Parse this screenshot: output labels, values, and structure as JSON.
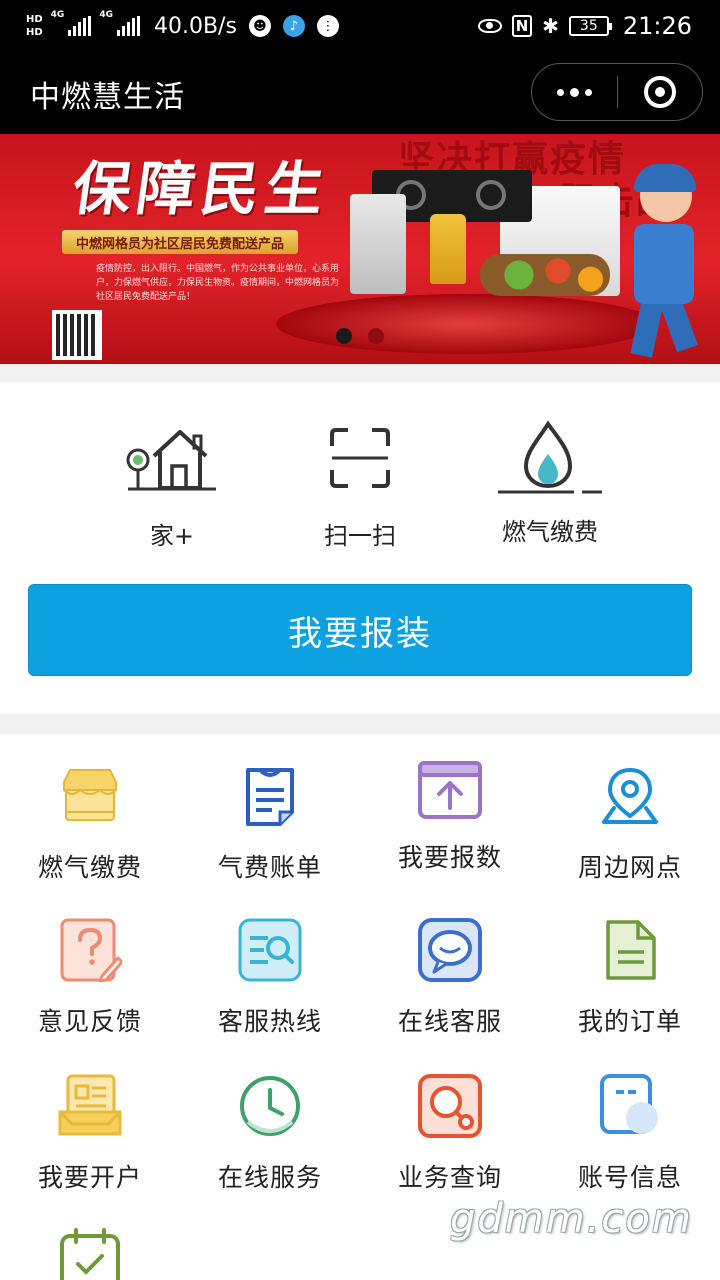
{
  "status_bar": {
    "hd1": "HD",
    "hd2": "HD",
    "net1": "4G",
    "net2": "4G",
    "speed": "40.0B/s",
    "nfc": "N",
    "bluetooth": "✱",
    "battery": "35",
    "time": "21:26"
  },
  "nav": {
    "title": "中燃慧生活"
  },
  "banner": {
    "headline": "保障民生",
    "bg_text_1": "坚决打赢疫情",
    "bg_text_2": "阻击战",
    "ribbon": "中燃网格员为社区居民免费配送产品",
    "small_text": "疫情防控，出入限行。中国燃气，作为公共事业单位，心系用户，力保燃气供应，力保民生物资。疫情期间，中燃网格员为社区居民免费配送产品！",
    "slides_total": 2,
    "slide_active": 1
  },
  "quick": {
    "items": [
      {
        "label": "家+",
        "icon": "house-icon"
      },
      {
        "label": "扫一扫",
        "icon": "scan-icon"
      },
      {
        "label": "燃气缴费",
        "icon": "gas-flame-icon"
      }
    ],
    "report_button": "我要报装"
  },
  "grid": {
    "items": [
      {
        "label": "燃气缴费",
        "icon": "storefront-icon",
        "color": "#f4c64a"
      },
      {
        "label": "气费账单",
        "icon": "bill-icon",
        "color": "#2b5fc2"
      },
      {
        "label": "我要报数",
        "icon": "upload-icon",
        "color": "#9b73c9"
      },
      {
        "label": "周边网点",
        "icon": "location-pin-icon",
        "color": "#1a8fd6"
      },
      {
        "label": "意见反馈",
        "icon": "feedback-icon",
        "color": "#f08a72"
      },
      {
        "label": "客服热线",
        "icon": "hotline-icon",
        "color": "#39b3d6"
      },
      {
        "label": "在线客服",
        "icon": "chat-icon",
        "color": "#3b6fcf"
      },
      {
        "label": "我的订单",
        "icon": "order-icon",
        "color": "#6f9a3a"
      },
      {
        "label": "我要开户",
        "icon": "open-account-icon",
        "color": "#e9b93a"
      },
      {
        "label": "在线服务",
        "icon": "clock-icon",
        "color": "#3fa06a"
      },
      {
        "label": "业务查询",
        "icon": "search-icon",
        "color": "#e8532e"
      },
      {
        "label": "账号信息",
        "icon": "account-card-icon",
        "color": "#3a8fe0"
      },
      {
        "label": "",
        "icon": "checklist-icon",
        "color": "#6f9a3a"
      }
    ]
  },
  "watermark": "gdmm.com"
}
